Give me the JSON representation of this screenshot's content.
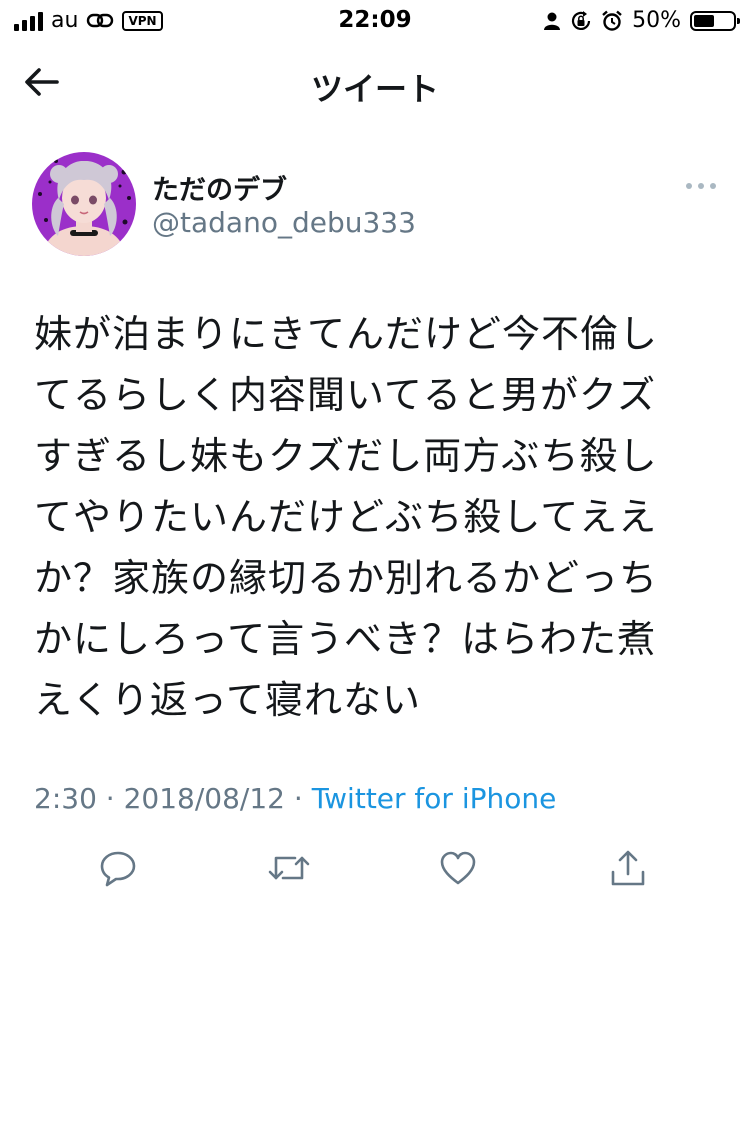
{
  "status_bar": {
    "carrier": "au",
    "vpn_label": "VPN",
    "time": "22:09",
    "battery_percent": "50%",
    "battery_level": 0.5,
    "icons": [
      "signal-icon",
      "link-icon",
      "vpn-badge",
      "person-icon",
      "rotation-lock-icon",
      "alarm-icon",
      "battery-icon"
    ]
  },
  "nav": {
    "title": "ツイート",
    "back_icon": "back-arrow-icon"
  },
  "tweet": {
    "display_name": "ただのデブ",
    "handle": "@tadano_debu333",
    "text_lines": [
      "妹が泊まりにきてんだけど今不倫し",
      "てるらしく内容聞いてると男がクズ",
      "すぎるし妹もクズだし両方ぶち殺し",
      "てやりたいんだけどぶち殺してええ",
      "か？家族の縁切るか別れるかどっち",
      "かにしろって言うべき？はらわた煮",
      "えくり返って寝れない"
    ],
    "time": "2:30",
    "separator": " · ",
    "date": "2018/08/12",
    "source": "Twitter for iPhone"
  },
  "actions": {
    "icons": [
      "reply-icon",
      "retweet-icon",
      "like-icon",
      "share-icon"
    ]
  },
  "colors": {
    "text": "#14171a",
    "secondary": "#657786",
    "link": "#1b95e0",
    "avatar_bg": "#9b2fc9"
  }
}
